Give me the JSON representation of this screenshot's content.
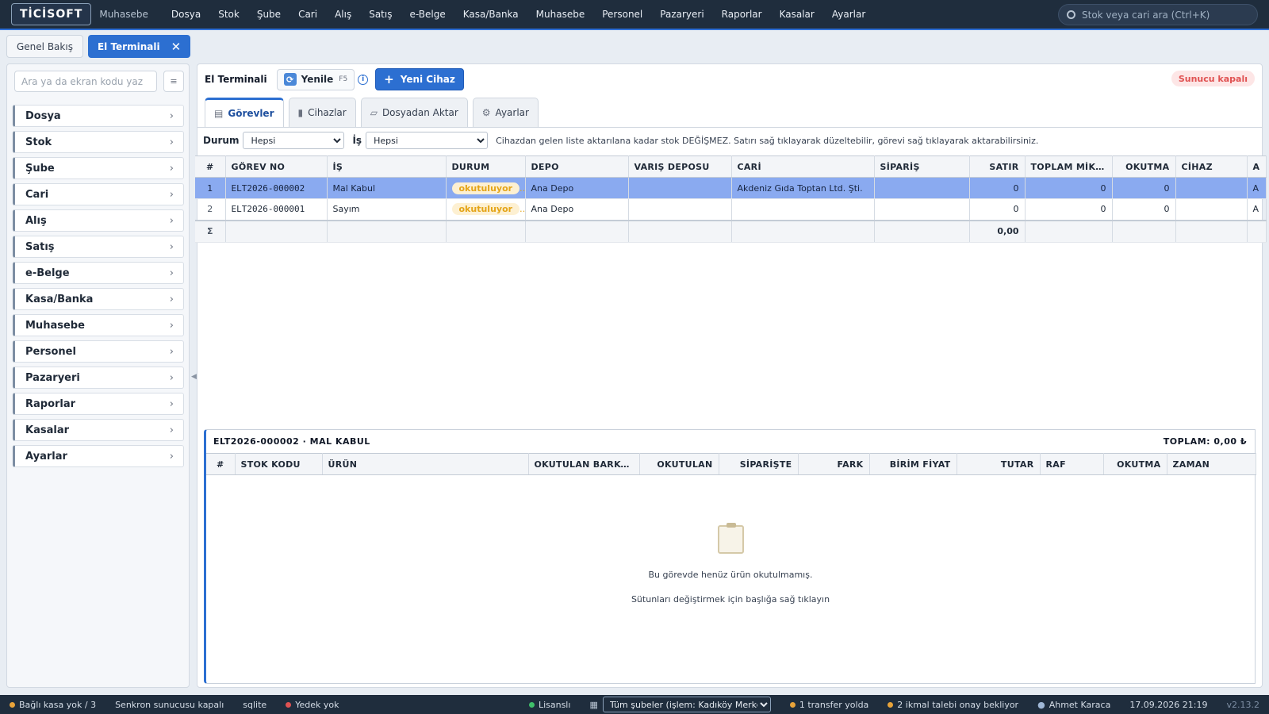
{
  "app": {
    "logo": "TİCİSOFT",
    "module": "Muhasebe"
  },
  "menu": [
    "Dosya",
    "Stok",
    "Şube",
    "Cari",
    "Alış",
    "Satış",
    "e-Belge",
    "Kasa/Banka",
    "Muhasebe",
    "Personel",
    "Pazaryeri",
    "Raporlar",
    "Kasalar",
    "Ayarlar"
  ],
  "search": {
    "placeholder": "Stok veya cari ara (Ctrl+K)"
  },
  "page_tabs": [
    {
      "label": "Genel Bakış",
      "active": false
    },
    {
      "label": "El Terminali",
      "active": true,
      "close": "✕"
    }
  ],
  "sidebar": {
    "search_placeholder": "Ara ya da ekran kodu yaz",
    "button": "≡",
    "items": [
      "Dosya",
      "Stok",
      "Şube",
      "Cari",
      "Alış",
      "Satış",
      "e-Belge",
      "Kasa/Banka",
      "Muhasebe",
      "Personel",
      "Pazaryeri",
      "Raporlar",
      "Kasalar",
      "Ayarlar"
    ],
    "chevron": "›",
    "collapse": "◀"
  },
  "toolbar": {
    "title": "El Terminali",
    "refresh_label": "Yenile",
    "refresh_key": "F5",
    "info": "i",
    "new_label": "Yeni Cihaz",
    "new_plus": "+",
    "server_status": "Sunucu kapalı"
  },
  "subtabs": [
    {
      "label": "Görevler",
      "icon": "clipboard-icon",
      "glyph": "▤",
      "active": true
    },
    {
      "label": "Cihazlar",
      "icon": "phone-icon",
      "glyph": "▮",
      "active": false
    },
    {
      "label": "Dosyadan Aktar",
      "icon": "folder-icon",
      "glyph": "▱",
      "active": false
    },
    {
      "label": "Ayarlar",
      "icon": "gear-icon",
      "glyph": "⚙",
      "active": false
    }
  ],
  "filters": {
    "durum_label": "Durum",
    "durum_value": "Hepsi",
    "is_label": "İş",
    "is_value": "Hepsi",
    "hint": "Cihazdan gelen liste aktarılana kadar stok DEĞİŞMEZ. Satırı sağ tıklayarak düzeltebilir, görevi sağ tıklayarak aktarabilirsiniz."
  },
  "tasks": {
    "columns": [
      "#",
      "GÖREV NO",
      "İŞ",
      "DURUM",
      "DEPO",
      "VARIŞ DEPOSU",
      "CARİ",
      "SİPARİŞ",
      "SATIR",
      "TOPLAM MİK...",
      "OKUTMA",
      "CİHAZ",
      "A"
    ],
    "rows": [
      {
        "idx": "1",
        "no": "ELT2026-000002",
        "is": "Mal Kabul",
        "durum": "okutuluyor",
        "depo": "Ana Depo",
        "varis": "",
        "cari": "Akdeniz Gıda Toptan Ltd. Şti.",
        "siparis": "",
        "satir": "0",
        "toplam": "0",
        "okutma": "0",
        "cihaz": "",
        "a": "A",
        "selected": true
      },
      {
        "idx": "2",
        "no": "ELT2026-000001",
        "is": "Sayım",
        "durum": "okutuluyor",
        "depo": "Ana Depo",
        "varis": "",
        "cari": "",
        "siparis": "",
        "satir": "0",
        "toplam": "0",
        "okutma": "0",
        "cihaz": "",
        "a": "A",
        "selected": false
      }
    ],
    "sum_symbol": "Σ",
    "sum_value": "0,00"
  },
  "detail": {
    "title": "ELT2026-000002 · MAL KABUL",
    "total": "TOPLAM: 0,00 ₺",
    "columns": [
      "#",
      "STOK KODU",
      "ÜRÜN",
      "OKUTULAN BARKOD",
      "OKUTULAN",
      "SİPARİŞTE",
      "FARK",
      "BİRİM FİYAT",
      "TUTAR",
      "RAF",
      "OKUTMA",
      "ZAMAN"
    ],
    "empty_line1": "Bu görevde henüz ürün okutulmamış.",
    "empty_line2": "Sütunları değiştirmek için başlığa sağ tıklayın"
  },
  "statusbar": {
    "kasa": "Bağlı kasa yok / 3",
    "sync": "Senkron sunucusu kapalı",
    "db": "sqlite",
    "backup": "Yedek yok",
    "license": "Lisanslı",
    "branch": "Tüm şubeler (işlem: Kadıköy Merkez)",
    "transfer": "1 transfer yolda",
    "ikmal": "2 ikmal talebi onay bekliyor",
    "user": "Ahmet Karaca",
    "datetime": "17.09.2026 21:19",
    "version": "v2.13.2"
  },
  "colors": {
    "accent": "#2c6fd1",
    "topbar": "#1f2d3d",
    "selected_row": "#8aaaf0",
    "status_pill": "#e4a417",
    "danger": "#e05252"
  }
}
